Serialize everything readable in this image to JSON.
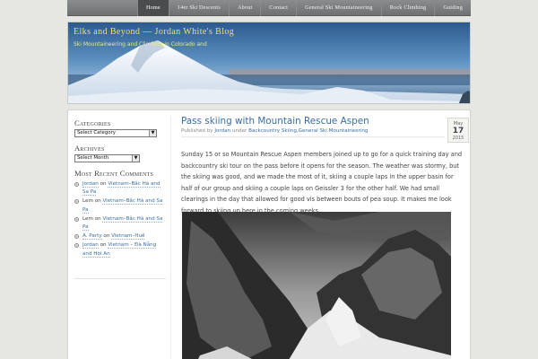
{
  "nav": {
    "items": [
      {
        "label": "Home",
        "active": true
      },
      {
        "label": "14er Ski Descents",
        "active": false
      },
      {
        "label": "About",
        "active": false
      },
      {
        "label": "Contact",
        "active": false
      },
      {
        "label": "General Ski Mountaineering",
        "active": false
      },
      {
        "label": "Rock Climbing",
        "active": false
      },
      {
        "label": "Guiding",
        "active": false
      }
    ]
  },
  "header": {
    "title": "Elks and Beyond — Jordan White's Blog",
    "description": "Ski Mountaineering and Climbing in Colorado and"
  },
  "sidebar": {
    "categories": {
      "title": "Categories",
      "selected": "Select Category"
    },
    "archives": {
      "title": "Archives",
      "selected": "Select Month"
    },
    "recent_comments": {
      "title": "Most Recent Comments",
      "items": [
        {
          "author": "Jordan",
          "on": "on",
          "post": "Vietnam–Bắc Hà and Sa Pa"
        },
        {
          "author": "Lem",
          "on": "on",
          "post": "Vietnam–Bắc Hà and Sa Pa"
        },
        {
          "author": "Lem",
          "on": "on",
          "post": "Vietnam–Bắc Hà and Sa Pa"
        },
        {
          "author": "A. Party",
          "on": "on",
          "post": "Vietnam–Huế"
        },
        {
          "author": "Jordan",
          "on": "on",
          "post": "Vietnam – Đà Nẵng and Hội An"
        }
      ]
    }
  },
  "post": {
    "title": "Pass skiing with Mountain Rescue Aspen",
    "meta": {
      "published_by": "Published by",
      "author": "Jordan",
      "under": "under",
      "categories": "Backcountry Skiing,General Ski Mountaineering"
    },
    "date": {
      "month": "May",
      "day": "17",
      "year": "2015"
    },
    "body": "Sunday 15 or so Mountain Rescue Aspen members joined up to go for a quick training day and backcountry ski tour on the pass before it opens for the season. The weather was stormy, but the skiing was good, and we made the most of it, skiing a couple laps in the upper basin for half of our group and skiing a couple laps on Geissler 3 for the other half. We had small clearings in the day that allowed for good vis between bouts of pea soup. It makes me look forward to skiing up here in the coming weeks."
  },
  "colors": {
    "link": "#3a6fa0",
    "header_title": "#e9e36a",
    "nav_active": "#4a4c4d"
  }
}
